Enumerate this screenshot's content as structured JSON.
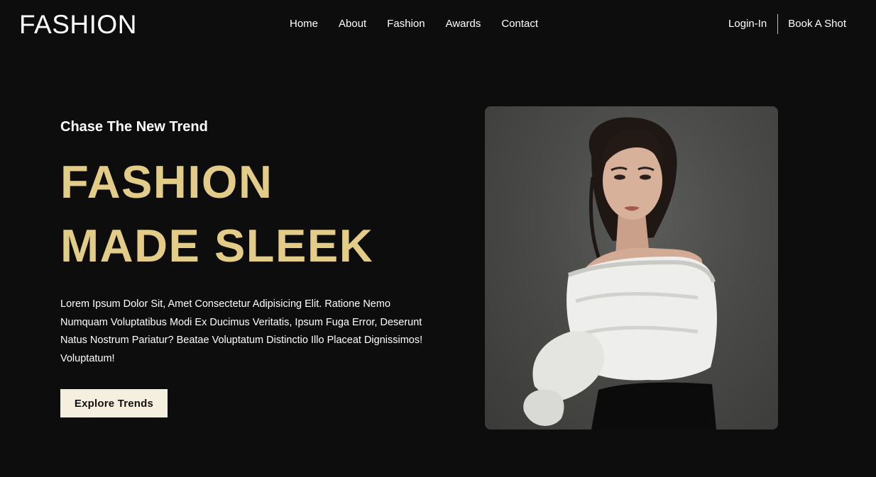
{
  "navbar": {
    "logo": "FASHION",
    "links": [
      "Home",
      "About",
      "Fashion",
      "Awards",
      "Contact"
    ],
    "login_label": "Login-In",
    "book_label": "Book A Shot"
  },
  "hero": {
    "kicker": "Chase The New Trend",
    "title_line1": "FASHION",
    "title_line2": "MADE SLEEK",
    "description": "Lorem Ipsum Dolor Sit, Amet Consectetur Adipisicing Elit. Ratione Nemo Numquam Voluptatibus Modi Ex Ducimus Veritatis, Ipsum Fuga Error, Deserunt Natus Nostrum Pariatur? Beatae Voluptatum Distinctio Illo Placeat Dignissimos! Voluptatum!",
    "cta_label": "Explore Trends",
    "image_icon": "model-portrait-photo"
  },
  "colors": {
    "background": "#0d0d0d",
    "accent_gold": "#e2cc88",
    "button_bg": "#f5efe0",
    "text": "#ffffff"
  }
}
